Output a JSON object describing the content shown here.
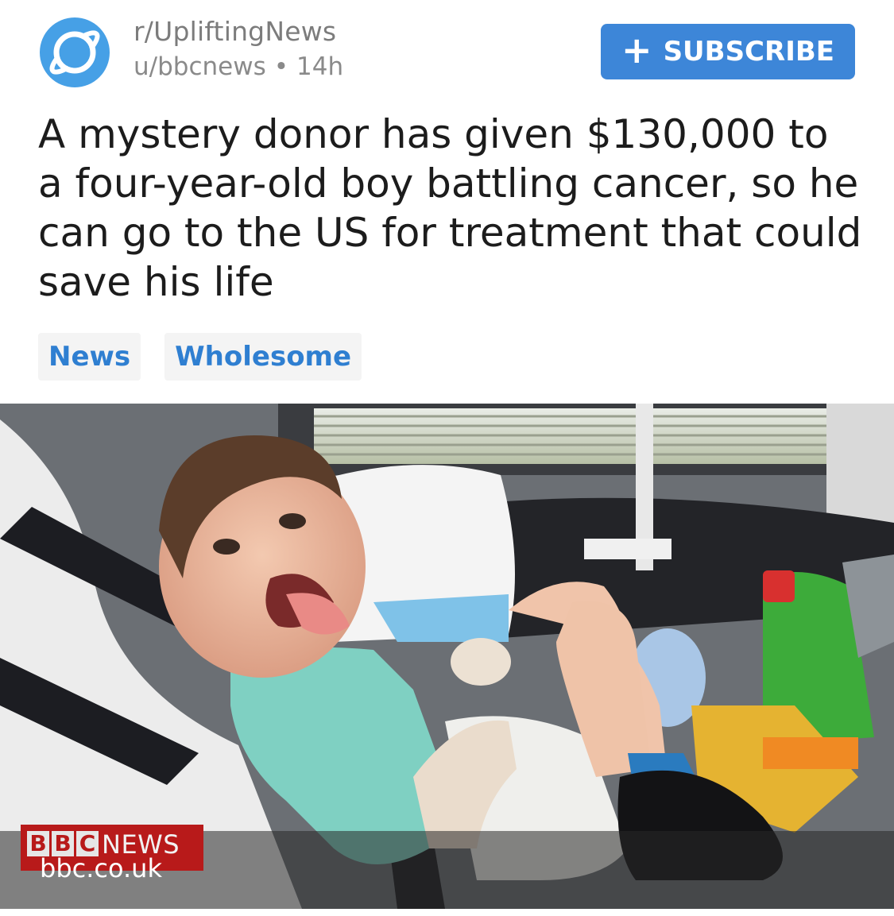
{
  "post": {
    "subreddit": "r/UpliftingNews",
    "author": "u/bbcnews",
    "separator": "•",
    "age": "14h",
    "subscribe_label": "SUBSCRIBE",
    "title": "A mystery donor has given $130,000 to a four-year-old boy battling cancer, so he can go to the US for treatment that could save his life",
    "flairs": [
      "News",
      "Wholesome"
    ]
  },
  "thumbnail": {
    "brand_letters": [
      "B",
      "B",
      "C"
    ],
    "brand_word": "NEWS",
    "url": "bbc.co.uk"
  },
  "colors": {
    "accent": "#3d86d8",
    "flair_text": "#2f7fd1",
    "avatar": "#46a0e6",
    "bbc_red": "#b81a1a"
  },
  "icons": {
    "subreddit_avatar": "planet-icon",
    "subscribe": "plus-icon"
  }
}
